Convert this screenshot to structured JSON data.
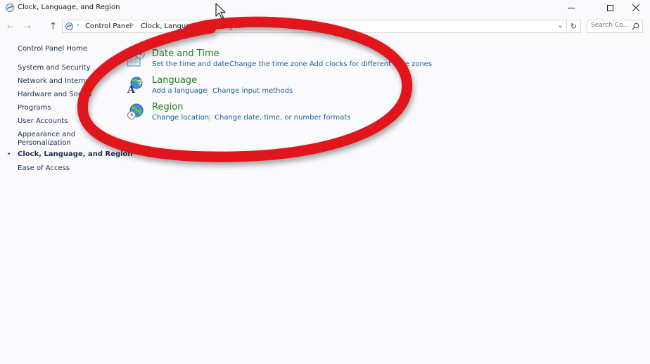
{
  "window": {
    "title": "Clock, Language, and Region"
  },
  "nav": {
    "breadcrumb": [
      "Control Panel",
      "Clock, Language, and Region"
    ],
    "search_placeholder": "Search Co..."
  },
  "sidebar": {
    "home": "Control Panel Home",
    "items": [
      {
        "label": "System and Security",
        "active": false
      },
      {
        "label": "Network and Internet",
        "active": false
      },
      {
        "label": "Hardware and Sound",
        "active": false
      },
      {
        "label": "Programs",
        "active": false
      },
      {
        "label": "User Accounts",
        "active": false
      },
      {
        "label": "Appearance and",
        "active": false
      },
      {
        "label": "Personalization",
        "active": false
      },
      {
        "label": "Clock, Language, and Region",
        "active": true
      },
      {
        "label": "Ease of Access",
        "active": false
      }
    ]
  },
  "categories": [
    {
      "title": "Date and Time",
      "icon": "date-time-icon",
      "links": [
        "Set the time and date",
        "Change the time zone",
        "Add clocks for different time zones"
      ]
    },
    {
      "title": "Language",
      "icon": "language-icon",
      "links": [
        "Add a language",
        "Change input methods"
      ]
    },
    {
      "title": "Region",
      "icon": "region-globe-icon",
      "links": [
        "Change location",
        "Change date, time, or number formats"
      ]
    }
  ],
  "colors": {
    "category_title": "#1e7d1e",
    "link": "#1b5fa8",
    "sidebar_text": "#1d2d52",
    "annotation_circle": "#e0161f"
  }
}
